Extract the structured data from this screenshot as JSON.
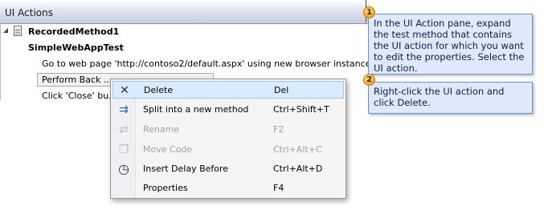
{
  "pane": {
    "title": "UI Actions"
  },
  "tree": {
    "method": "RecordedMethod1",
    "test": "SimpleWebAppTest",
    "action_goto": "Go to web page 'http://contoso2/default.aspx' using new browser instance",
    "action_back": "Perform Back ...",
    "action_click": "Click 'Close' bu..."
  },
  "menu": {
    "items": [
      {
        "icon": "close-icon",
        "glyph": "✕",
        "label": "Delete",
        "key": "Del",
        "enabled": true,
        "highlighted": true
      },
      {
        "icon": "split-method-icon",
        "glyph": "⇉",
        "label": "Split into a new method",
        "key": "Ctrl+Shift+T",
        "enabled": true,
        "highlighted": false
      },
      {
        "icon": "rename-icon",
        "glyph": "⇄",
        "label": "Rename",
        "key": "F2",
        "enabled": false,
        "highlighted": false
      },
      {
        "icon": "move-code-icon",
        "glyph": "❐",
        "label": "Move Code",
        "key": "Ctrl+Alt+C",
        "enabled": false,
        "highlighted": false
      },
      {
        "icon": "stopwatch-icon",
        "glyph": "◷",
        "label": "Insert Delay Before",
        "key": "Ctrl+Alt+D",
        "enabled": true,
        "highlighted": false
      },
      {
        "icon": "",
        "glyph": "",
        "label": "Properties",
        "key": "F4",
        "enabled": true,
        "highlighted": false
      }
    ]
  },
  "callouts": [
    {
      "number": "1",
      "text": "In the UI Action pane, expand the test method that contains the UI action for which you want to edit the properties. Select the UI action."
    },
    {
      "number": "2",
      "text": "Right-click the UI action and click Delete."
    }
  ],
  "colors": {
    "highlight": "#d8ebff",
    "callout_bg": "#dfe9fb",
    "callout_border": "#6b8fd1",
    "badge": "#f0a31c"
  }
}
